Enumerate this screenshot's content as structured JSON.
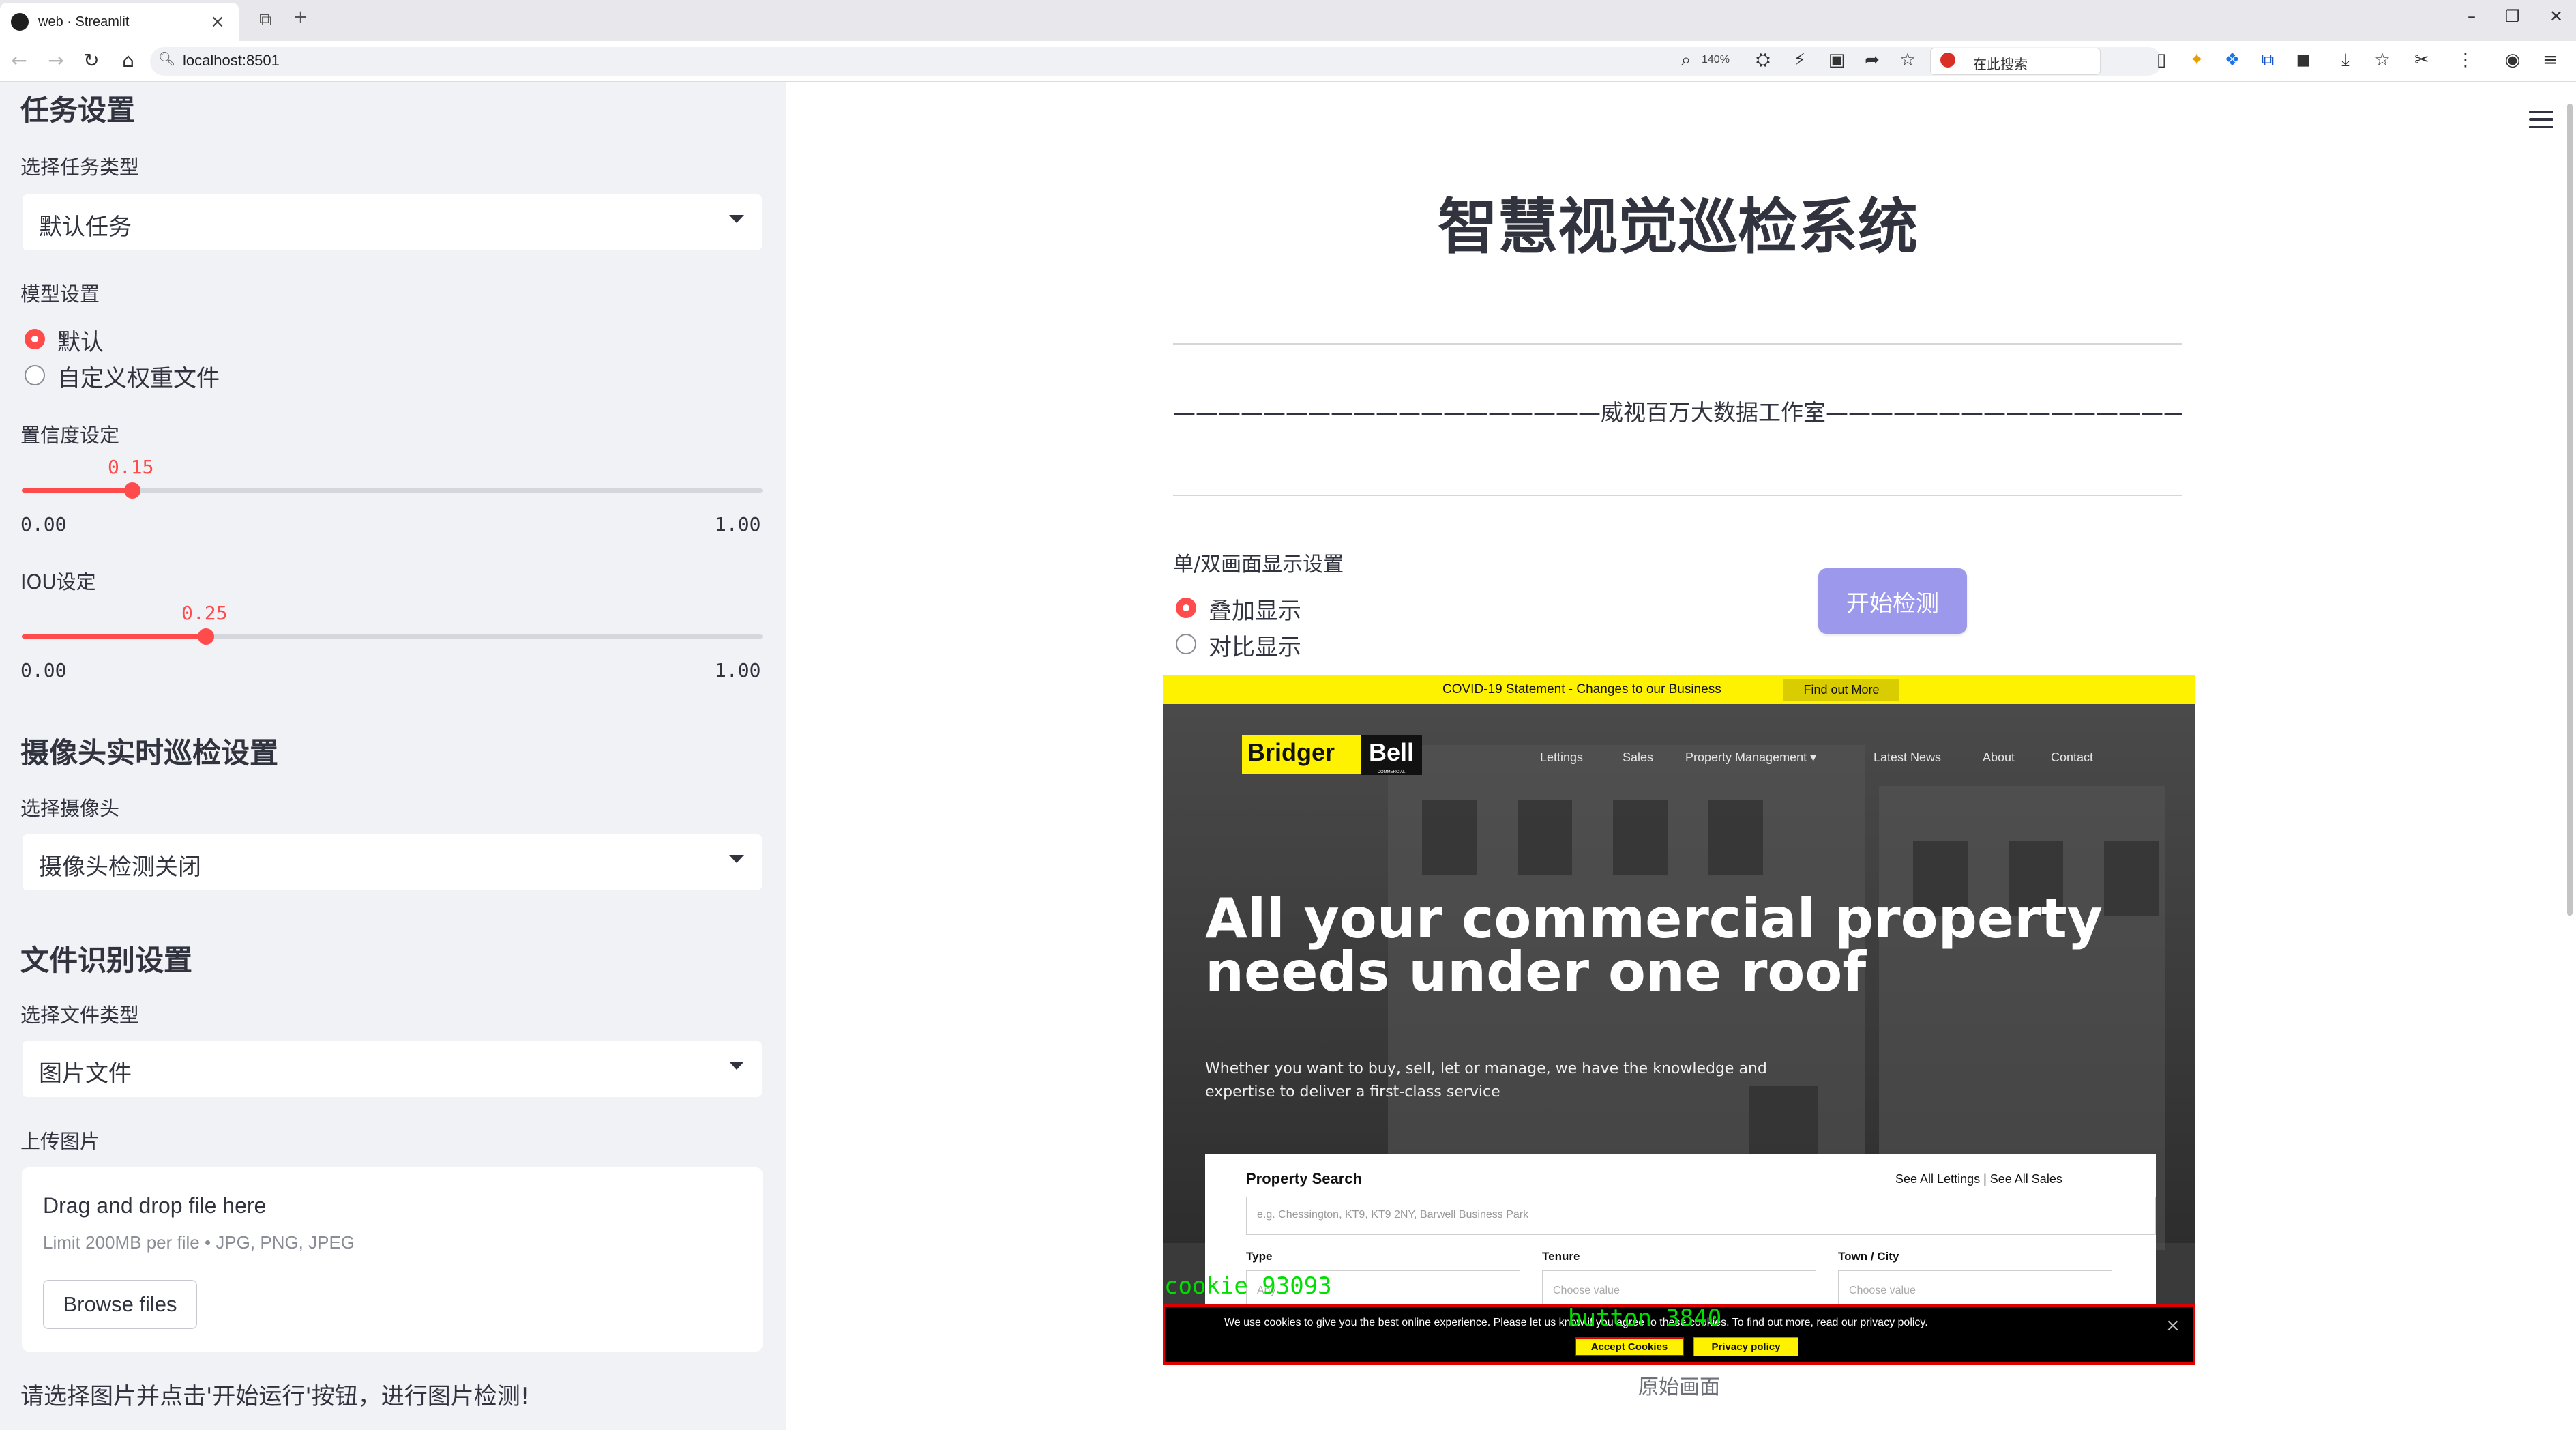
{
  "browser": {
    "tab_title": "web · Streamlit",
    "url": "localhost:8501",
    "zoom": "140%",
    "search_label": "在此搜索"
  },
  "sidebar": {
    "task_header": "任务设置",
    "task_type_label": "选择任务类型",
    "task_type_value": "默认任务",
    "model_label": "模型设置",
    "model_options": [
      "默认",
      "自定义权重文件"
    ],
    "model_selected": "默认",
    "conf_label": "置信度设定",
    "conf_value": "0.15",
    "conf_min": "0.00",
    "conf_max": "1.00",
    "iou_label": "IOU设定",
    "iou_value": "0.25",
    "iou_min": "0.00",
    "iou_max": "1.00",
    "camera_header": "摄像头实时巡检设置",
    "camera_label": "选择摄像头",
    "camera_value": "摄像头检测关闭",
    "file_header": "文件识别设置",
    "file_type_label": "选择文件类型",
    "file_type_value": "图片文件",
    "upload_label": "上传图片",
    "upload_title": "Drag and drop file here",
    "upload_hint": "Limit 200MB per file • JPG, PNG, JPEG",
    "browse_label": "Browse files",
    "note": "请选择图片并点击'开始运行'按钮，进行图片检测!"
  },
  "main": {
    "title": "智慧视觉巡检系统",
    "studio": "———————————————————威视百万大数据工作室——————————————————————",
    "mode_label": "单/双画面显示设置",
    "mode_options": [
      "叠加显示",
      "对比显示"
    ],
    "mode_selected": "叠加显示",
    "start_button": "开始检测",
    "caption": "原始画面"
  },
  "detection_image": {
    "covid_text": "COVID-19 Statement - Changes to our Business",
    "covid_button": "Find out More",
    "logo_a": "Bridger",
    "logo_b": "Bell",
    "logo_sub": "COMMERCIAL",
    "nav": [
      "Lettings",
      "Sales",
      "Property Management ▾",
      "Latest News",
      "About",
      "Contact"
    ],
    "headline": "All your commercial property needs under one roof",
    "subtext": "Whether you want to buy, sell, let or manage, we have the knowledge and expertise to deliver a first-class service",
    "search_title": "Property Search",
    "search_links": "See All Lettings | See All Sales",
    "search_placeholder": "e.g. Chessington, KT9, KT9 2NY, Barwell Business Park",
    "fields": [
      {
        "label": "Type",
        "placeholder": "Any"
      },
      {
        "label": "Tenure",
        "placeholder": "Choose value"
      },
      {
        "label": "Town / City",
        "placeholder": "Choose value"
      }
    ],
    "cookie_text": "We use cookies to give you the best online experience. Please let us know if you agree to these cookies. To find out more, read our privacy policy.",
    "accept_label": "Accept Cookies",
    "privacy_label": "Privacy policy",
    "det_labels": [
      "cookie 93093",
      "button 3840"
    ]
  }
}
